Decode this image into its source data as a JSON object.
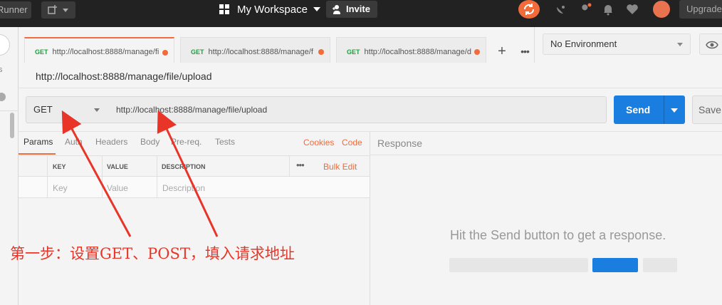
{
  "topbar": {
    "runner_label": "Runner",
    "workspace_label": "My Workspace",
    "invite_label": "Invite",
    "upgrade_label": "Upgrade"
  },
  "sidebar": {
    "partial_text": "s"
  },
  "tabs": [
    {
      "method": "GET",
      "url": "http://localhost:8888/manage/fi",
      "active": true
    },
    {
      "method": "GET",
      "url": "http://localhost:8888/manage/f",
      "active": false
    },
    {
      "method": "GET",
      "url": "http://localhost:8888/manage/d",
      "active": false
    }
  ],
  "environment": {
    "selected": "No Environment"
  },
  "request": {
    "title": "http://localhost:8888/manage/file/upload",
    "method": "GET",
    "url": "http://localhost:8888/manage/file/upload",
    "send_label": "Send",
    "save_label": "Save"
  },
  "param_tabs": [
    "Params",
    "Auth",
    "Headers",
    "Body",
    "Pre-req.",
    "Tests"
  ],
  "param_links": {
    "cookies": "Cookies",
    "code": "Code"
  },
  "params_table": {
    "headers": [
      "KEY",
      "VALUE",
      "DESCRIPTION"
    ],
    "bulk_edit": "Bulk Edit",
    "placeholders": [
      "Key",
      "Value",
      "Description"
    ]
  },
  "response": {
    "title": "Response",
    "empty_message": "Hit the Send button to get a response."
  },
  "annotation": {
    "text": "第一步：设置GET、POST，填入请求地址",
    "color": "#e83528"
  },
  "colors": {
    "accent": "#f26b3a",
    "send_blue": "#1a7de0",
    "get_green": "#1d9f3e"
  }
}
